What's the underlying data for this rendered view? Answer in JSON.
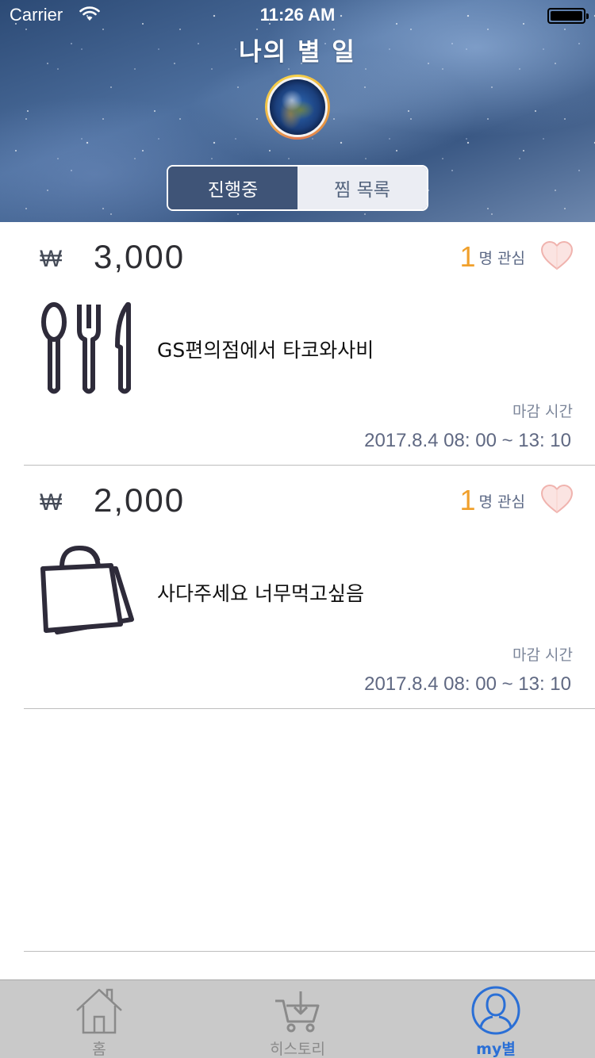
{
  "status_bar": {
    "carrier": "Carrier",
    "time": "11:26 AM"
  },
  "header": {
    "title": "나의 별 일",
    "avatar_icon": "earth-avatar"
  },
  "segmented": {
    "tabs": [
      {
        "label": "진행중",
        "selected": true
      },
      {
        "label": "찜 목록",
        "selected": false
      }
    ]
  },
  "items": [
    {
      "currency_symbol": "₩",
      "price": "3,000",
      "interest_count": "1",
      "interest_label": "명 관심",
      "icon": "utensils-icon",
      "title": "GS편의점에서 타코와사비",
      "deadline_label": "마감 시간",
      "deadline_time": "2017.8.4 08: 00 ~  13: 10"
    },
    {
      "currency_symbol": "₩",
      "price": "2,000",
      "interest_count": "1",
      "interest_label": "명 관심",
      "icon": "shopping-bag-icon",
      "title": "사다주세요 너무먹고싶음",
      "deadline_label": "마감 시간",
      "deadline_time": "2017.8.4 08: 00 ~  13: 10"
    }
  ],
  "tabbar": {
    "items": [
      {
        "label": "홈",
        "icon": "home-icon",
        "active": false
      },
      {
        "label": "히스토리",
        "icon": "cart-icon",
        "active": false
      },
      {
        "label": "my별",
        "icon": "profile-icon",
        "active": true
      }
    ]
  },
  "colors": {
    "accent": "#2a6fd6",
    "interest_count": "#f0a02c",
    "segment_active": "#3f5477",
    "heart_fill": "#fbe4e2",
    "heart_stroke": "#f0b3ae"
  }
}
